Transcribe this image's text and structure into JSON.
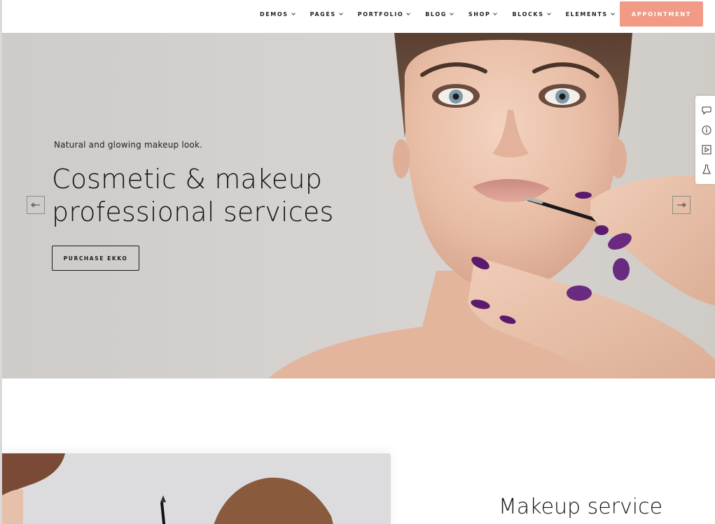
{
  "nav": {
    "items": [
      {
        "label": "DEMOS"
      },
      {
        "label": "PAGES"
      },
      {
        "label": "PORTFOLIO"
      },
      {
        "label": "BLOG"
      },
      {
        "label": "SHOP"
      },
      {
        "label": "BLOCKS"
      },
      {
        "label": "ELEMENTS"
      }
    ],
    "cta_label": "APPOINTMENT"
  },
  "hero": {
    "eyebrow": "Natural and glowing makeup look.",
    "title_line1": "Cosmetic & makeup",
    "title_line2": "professional services",
    "button_label": "PURCHASE EKKO",
    "prev_icon": "arrow-left-icon",
    "next_icon": "arrow-right-icon"
  },
  "side_tools": [
    {
      "icon": "chat-icon"
    },
    {
      "icon": "info-icon"
    },
    {
      "icon": "video-icon"
    },
    {
      "icon": "flask-icon"
    }
  ],
  "section2": {
    "title": "Makeup service"
  },
  "colors": {
    "accent": "#f19a85",
    "text": "#141414",
    "hero_bg": "#d5d2cf"
  }
}
